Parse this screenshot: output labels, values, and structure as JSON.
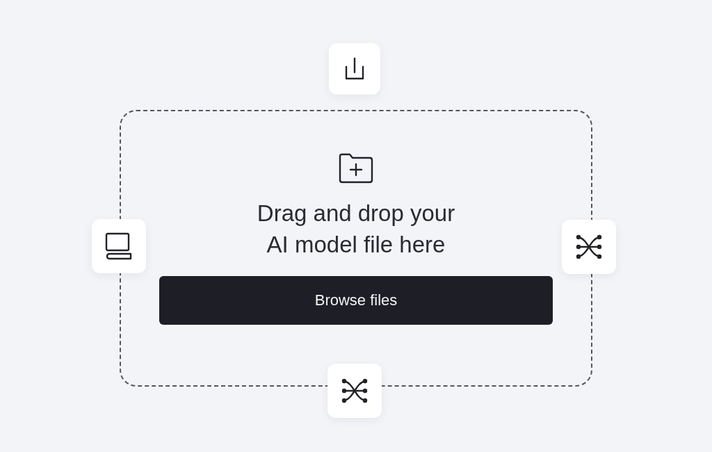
{
  "dropzone": {
    "heading": "Drag and drop your AI model file here",
    "button": "Browse files"
  }
}
